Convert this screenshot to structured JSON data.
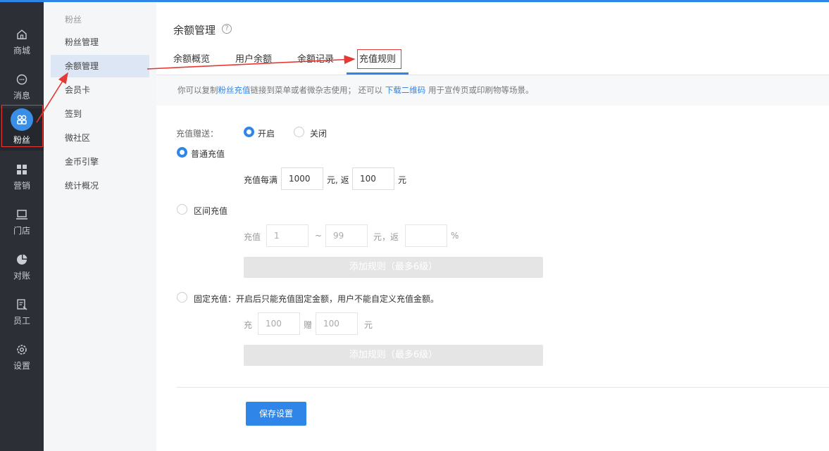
{
  "nav": {
    "items": [
      {
        "label": "商城",
        "icon": "home-icon"
      },
      {
        "label": "消息",
        "icon": "message-icon"
      },
      {
        "label": "粉丝",
        "icon": "fans-icon",
        "active": true
      },
      {
        "label": "营销",
        "icon": "grid-icon"
      },
      {
        "label": "门店",
        "icon": "store-icon"
      },
      {
        "label": "对账",
        "icon": "pie-icon"
      },
      {
        "label": "员工",
        "icon": "staff-icon"
      },
      {
        "label": "设置",
        "icon": "gear-icon"
      }
    ]
  },
  "sub": {
    "title": "粉丝",
    "items": [
      "粉丝管理",
      "余额管理",
      "会员卡",
      "签到",
      "微社区",
      "金币引擎",
      "统计概况"
    ],
    "active_index": 1
  },
  "page": {
    "title": "余额管理",
    "help": "?",
    "tabs": [
      "余额概览",
      "用户余额",
      "余额记录",
      "充值规则"
    ],
    "active_tab": 3
  },
  "notice": {
    "prefix": "你可以复制",
    "link1": "粉丝充值",
    "middle": "链接到菜单或者微杂志使用； 还可以",
    "link2": "下载二维码",
    "suffix": "用于宣传页或印刷物等场景。"
  },
  "form": {
    "gift_label": "充值赠送：",
    "gift_on": "开启",
    "gift_off": "关闭",
    "normal": {
      "label": "普通充值",
      "prefix": "充值每满",
      "amount": "1000",
      "mid": "元, 返",
      "bonus": "100",
      "unit": "元"
    },
    "range": {
      "label": "区间充值",
      "prefix": "充值",
      "from": "1",
      "tilde": "~",
      "to": "99",
      "mid": "元，返",
      "percent": "",
      "unit": "%",
      "add_button": "添加规则（最多6级）"
    },
    "fixed": {
      "label": "固定充值：开启后只能充值固定金额，用户不能自定义充值金额。",
      "charge": "充",
      "charge_value": "100",
      "gift": "赠",
      "gift_value": "100",
      "unit": "元",
      "add_button": "添加规则（最多6级）"
    },
    "save_button": "保存设置"
  },
  "colors": {
    "accent": "#2f86e8",
    "nav_bg": "#2c2f36",
    "highlight": "#e53935"
  }
}
